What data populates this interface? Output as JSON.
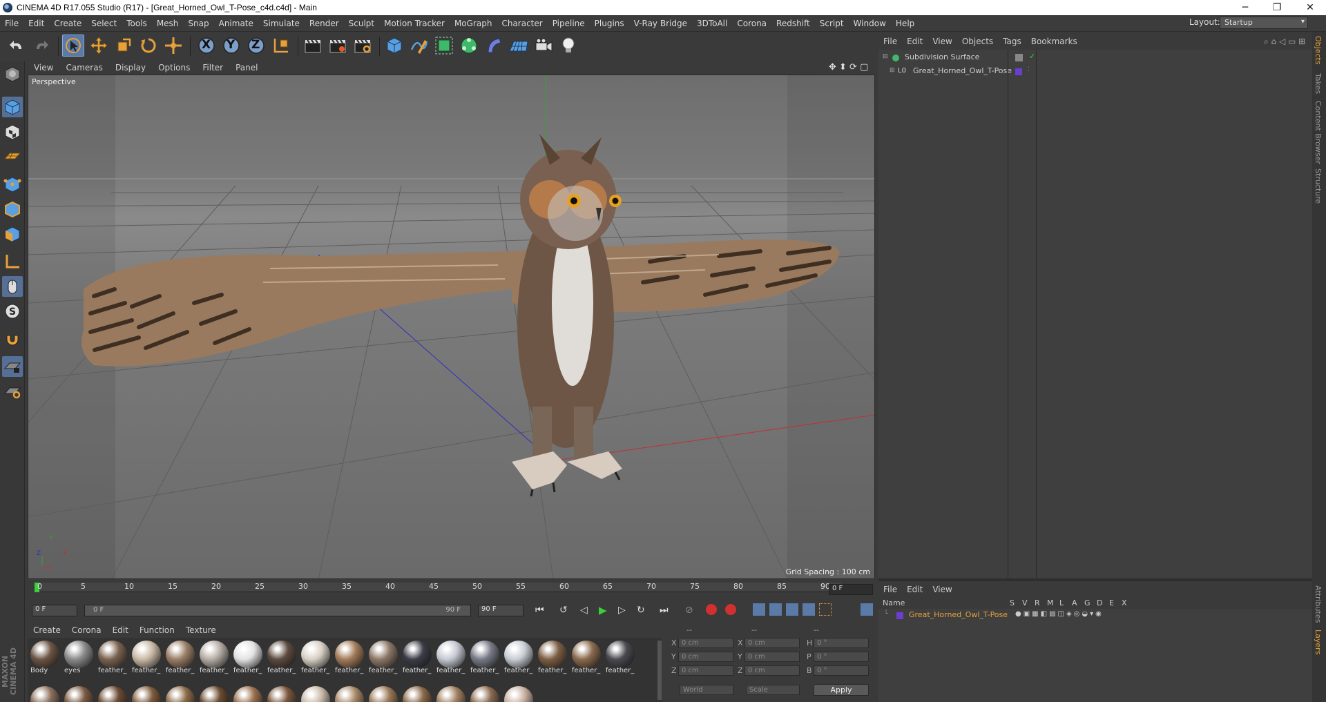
{
  "window": {
    "title": "CINEMA 4D R17.055 Studio (R17) - [Great_Horned_Owl_T-Pose_c4d.c4d] - Main",
    "minimize_glyph": "─",
    "restore_glyph": "❐",
    "close_glyph": "✕"
  },
  "menu": [
    "File",
    "Edit",
    "Create",
    "Select",
    "Tools",
    "Mesh",
    "Snap",
    "Animate",
    "Simulate",
    "Render",
    "Sculpt",
    "Motion Tracker",
    "MoGraph",
    "Character",
    "Pipeline",
    "Plugins",
    "V-Ray Bridge",
    "3DToAll",
    "Corona",
    "Redshift",
    "Script",
    "Window",
    "Help"
  ],
  "layout": {
    "label": "Layout:",
    "value": "Startup"
  },
  "toolbar": {
    "axis_x": "X",
    "axis_y": "Y",
    "axis_z": "Z"
  },
  "viewport": {
    "menu": [
      "View",
      "Cameras",
      "Display",
      "Options",
      "Filter",
      "Panel"
    ],
    "label": "Perspective",
    "grid_spacing": "Grid Spacing : 100 cm",
    "axis_y": "Y",
    "axis_x": "X",
    "axis_z": "Z"
  },
  "timeline": {
    "ticks": [
      "0",
      "5",
      "10",
      "15",
      "20",
      "25",
      "30",
      "35",
      "40",
      "45",
      "50",
      "55",
      "60",
      "65",
      "70",
      "75",
      "80",
      "85",
      "90"
    ],
    "current_frame_field": "0 F",
    "start_field": "0 F",
    "range_start": "0 F",
    "range_end": "90 F",
    "end_field": "90 F"
  },
  "materials": {
    "menu": [
      "Create",
      "Corona",
      "Edit",
      "Function",
      "Texture"
    ],
    "row1": [
      {
        "name": "Body",
        "color": "#6b5444"
      },
      {
        "name": "eyes",
        "color": "#8a8a8a"
      },
      {
        "name": "feather_",
        "color": "#7a6250"
      },
      {
        "name": "feather_",
        "color": "#c9b9a5"
      },
      {
        "name": "feather_",
        "color": "#9a7e66"
      },
      {
        "name": "feather_",
        "color": "#b5aca4"
      },
      {
        "name": "feather_",
        "color": "#e2e2e2"
      },
      {
        "name": "feather_",
        "color": "#5c4a3e"
      },
      {
        "name": "feather_",
        "color": "#d7cfc4"
      },
      {
        "name": "feather_",
        "color": "#a37b5a"
      },
      {
        "name": "feather_",
        "color": "#8c7866"
      },
      {
        "name": "feather_",
        "color": "#3c3c48"
      },
      {
        "name": "feather_",
        "color": "#c4c8d0"
      },
      {
        "name": "feather_",
        "color": "#777a86"
      },
      {
        "name": "feather_",
        "color": "#c8ccd4"
      },
      {
        "name": "feather_",
        "color": "#7c5e44"
      },
      {
        "name": "feather_",
        "color": "#8a6a4e"
      },
      {
        "name": "feather_",
        "color": "#4a4a50"
      }
    ],
    "row2_colors": [
      "#8a6f5a",
      "#7a5a42",
      "#6b4a33",
      "#7e5a3c",
      "#8c6a48",
      "#6a4a30",
      "#9a7050",
      "#7a563a",
      "#c8b8a8",
      "#a88868",
      "#9a7858",
      "#8a6848",
      "#a08060",
      "#8a6a50",
      "#c8b0a0"
    ]
  },
  "coordinates": {
    "col1": "--",
    "col2": "--",
    "col3": "--",
    "rows": [
      {
        "l1": "X",
        "v1": "0 cm",
        "l2": "X",
        "v2": "0 cm",
        "l3": "H",
        "v3": "0 °"
      },
      {
        "l1": "Y",
        "v1": "0 cm",
        "l2": "Y",
        "v2": "0 cm",
        "l3": "P",
        "v3": "0 °"
      },
      {
        "l1": "Z",
        "v1": "0 cm",
        "l2": "Z",
        "v2": "0 cm",
        "l3": "B",
        "v3": "0 °"
      }
    ],
    "mode": "World",
    "type": "Scale",
    "apply": "Apply"
  },
  "object_manager": {
    "menu": [
      "File",
      "Edit",
      "View",
      "Objects",
      "Tags",
      "Bookmarks"
    ],
    "objects": [
      {
        "name": "Subdivision Surface",
        "color": "#6cc070"
      },
      {
        "name": "Great_Horned_Owl_T-Pose",
        "color": "#b0b0b0",
        "swatch": "#6a3fd0"
      }
    ]
  },
  "layer_manager": {
    "menu": [
      "File",
      "Edit",
      "View"
    ],
    "columns": [
      "Name",
      "S",
      "V",
      "R",
      "M",
      "L",
      "A",
      "G",
      "D",
      "E",
      "X"
    ],
    "layer": {
      "name": "Great_Horned_Owl_T-Pose",
      "color": "#e8a13a",
      "swatch": "#6a3fd0"
    }
  },
  "right_tabs": [
    "Objects",
    "Takes",
    "Content Browser",
    "Structure",
    "Attributes",
    "Layers"
  ],
  "maxon": "MAXON CINEMA 4D"
}
